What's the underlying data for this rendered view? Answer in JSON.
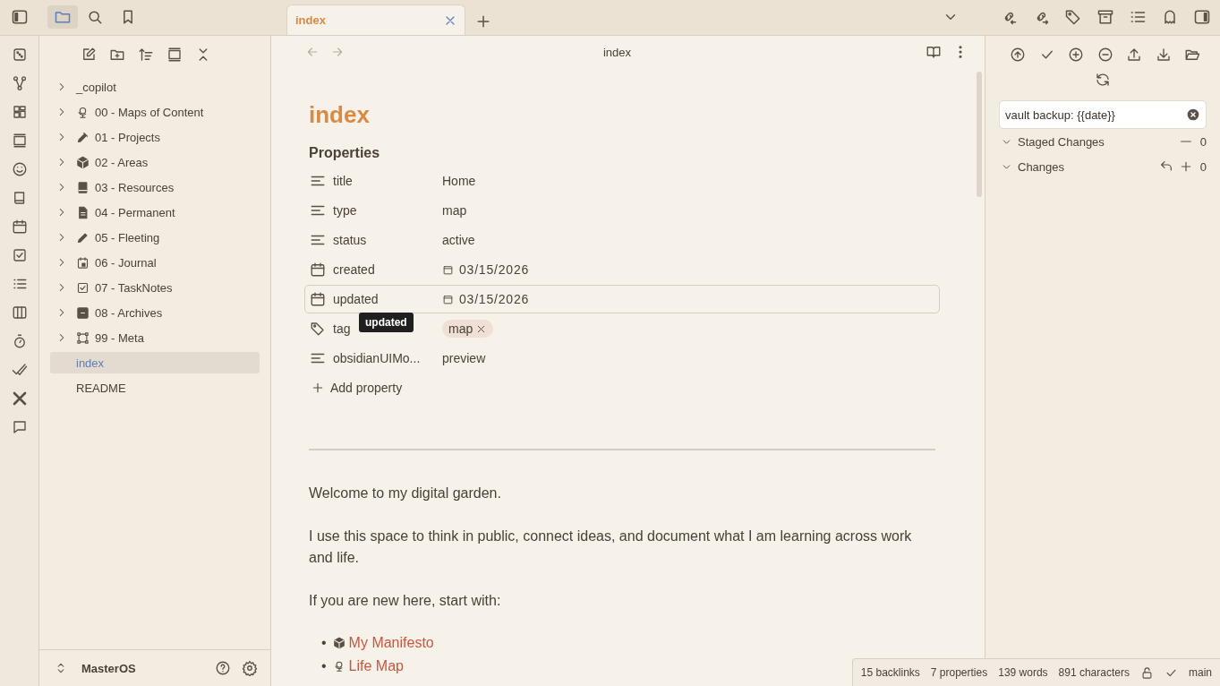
{
  "tabs": [
    {
      "label": "index",
      "selected": true
    }
  ],
  "file_tree": {
    "items": [
      {
        "label": "_copilot",
        "kind": "folder",
        "selected": false
      },
      {
        "label": "00 - Maps of Content",
        "kind": "folder",
        "selected": false
      },
      {
        "label": "01 - Projects",
        "kind": "folder",
        "selected": false
      },
      {
        "label": "02 - Areas",
        "kind": "folder",
        "selected": false
      },
      {
        "label": "03 - Resources",
        "kind": "folder",
        "selected": false
      },
      {
        "label": "04 - Permanent",
        "kind": "folder",
        "selected": false
      },
      {
        "label": "05 - Fleeting",
        "kind": "folder",
        "selected": false
      },
      {
        "label": "06 - Journal",
        "kind": "folder",
        "selected": false
      },
      {
        "label": "07 - TaskNotes",
        "kind": "folder",
        "selected": false
      },
      {
        "label": "08 - Archives",
        "kind": "folder",
        "selected": false
      },
      {
        "label": "99 - Meta",
        "kind": "folder",
        "selected": false
      },
      {
        "label": "index",
        "kind": "file",
        "selected": true
      },
      {
        "label": "README",
        "kind": "file",
        "selected": false
      }
    ]
  },
  "vault": {
    "name": "MasterOS"
  },
  "editor": {
    "header_title": "index",
    "title": "index",
    "properties_heading": "Properties",
    "properties": [
      {
        "name": "title",
        "kind": "text",
        "value": "Home",
        "hovered": false
      },
      {
        "name": "type",
        "kind": "text",
        "value": "map",
        "hovered": false
      },
      {
        "name": "status",
        "kind": "text",
        "value": "active",
        "hovered": false
      },
      {
        "name": "created",
        "kind": "date",
        "value": "03/15/2026",
        "hovered": false
      },
      {
        "name": "updated",
        "kind": "date",
        "value": "03/15/2026",
        "hovered": true
      },
      {
        "name": "tag",
        "kind": "tags",
        "value": "map",
        "hovered": false
      },
      {
        "name": "obsidianUIMo...",
        "kind": "text",
        "value": "preview",
        "hovered": false
      }
    ],
    "tooltip": "updated",
    "add_property": "Add property",
    "paragraphs": [
      "Welcome to my digital garden.",
      "I use this space to think in public, connect ideas, and document what I am learning across work and life.",
      "If you are new here, start with:"
    ],
    "links": [
      {
        "bullet": "•",
        "label": "My Manifesto"
      },
      {
        "bullet": "•",
        "label": "Life Map"
      }
    ]
  },
  "git_panel": {
    "commit_message": "vault backup: {{date}}",
    "sections": [
      {
        "label": "Staged Changes",
        "count": "0",
        "expanded": true,
        "kind": "staged"
      },
      {
        "label": "Changes",
        "count": "0",
        "expanded": true,
        "kind": "changes"
      }
    ]
  },
  "status_bar": {
    "items": [
      "15 backlinks",
      "7 properties",
      "139 words",
      "891 characters"
    ],
    "branch": "main"
  }
}
